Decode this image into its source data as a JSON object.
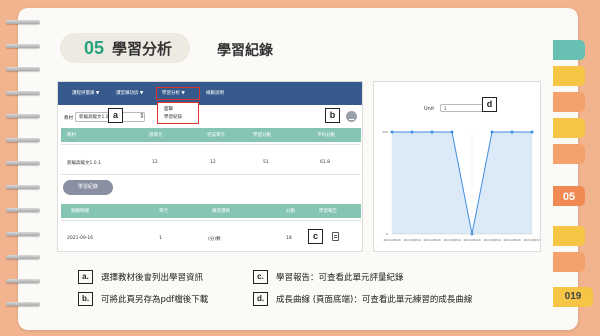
{
  "header": {
    "section_number": "05",
    "section_title": "學習分析",
    "subtitle": "學習紀錄"
  },
  "side_tab": {
    "number": "05"
  },
  "page_number": "019",
  "left_screenshot": {
    "nav": [
      "課程評量庫 ▼",
      "課堂練功房 ▼",
      "學習分析 ▼",
      "線數說明"
    ],
    "dropdown_items": [
      "面擊",
      "學習紀錄"
    ],
    "select_label": "教材",
    "select_value": "新編高級文1.0.1",
    "table1_headers": [
      "教材",
      "週單元",
      "完成單元",
      "學習分數",
      "平均分數"
    ],
    "table1_row": [
      "新編高級文1.0.1",
      "12",
      "12",
      "51",
      "61.8"
    ],
    "record_button": "學習紀錄",
    "table2_headers": [
      "測驗時間",
      "單元",
      "練習課目",
      "分數",
      "學習報告"
    ],
    "table2_row": [
      "2021-09-16",
      "1",
      "(分)類",
      "18"
    ]
  },
  "right_screenshot": {
    "unit_label": "Unit",
    "unit_value": "1"
  },
  "chart_data": {
    "type": "line",
    "x": [
      "2021/08/16",
      "2021/08/16",
      "2021/08/16",
      "2021/08/16",
      "2021/08/16",
      "2021/08/16",
      "2021/08/16",
      "2021/08/16"
    ],
    "values": [
      100,
      100,
      100,
      100,
      0,
      100,
      100,
      100
    ],
    "ylim": [
      0,
      100
    ],
    "color": "#3d8fe0",
    "fill": "#dce9f7"
  },
  "markers": {
    "a": "a",
    "b": "b",
    "c": "c",
    "d": "d"
  },
  "legend": [
    {
      "key": "a.",
      "text": "選擇教材後會列出學習資訊"
    },
    {
      "key": "b.",
      "text": "可將此頁另存為pdf檔後下載"
    },
    {
      "key": "c.",
      "text": "學習報告：可查看此單元評量紀錄"
    },
    {
      "key": "d.",
      "text": "成長曲線 (頁面底端)：可查看此單元練習的成長曲線"
    }
  ],
  "colors": {
    "background": "#f2b48f",
    "accent_green": "#26a17e",
    "nav_blue": "#375a8c",
    "table_header": "#86c5b3",
    "highlight_red": "#e0322b"
  }
}
